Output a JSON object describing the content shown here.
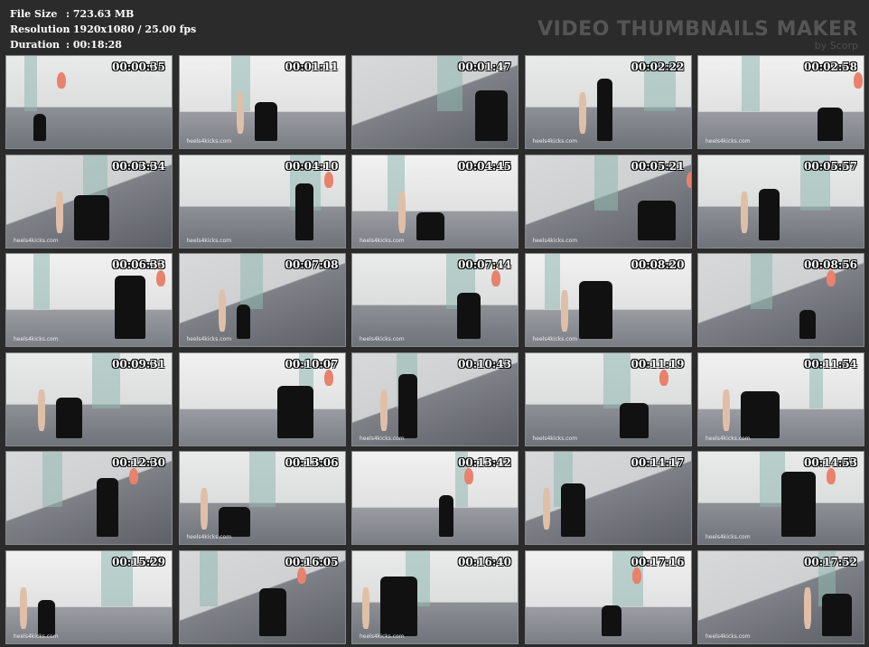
{
  "header": {
    "info": [
      {
        "label": "File Size",
        "value": ":  723.63 MB"
      },
      {
        "label": "Resolution",
        "value": ":  1920x1080 / 25.00 fps"
      },
      {
        "label": "Duration",
        "value": ":  00:18:28"
      }
    ],
    "brand": "VIDEO THUMBNAILS MAKER",
    "brand_sub": "by Scorp"
  },
  "thumbnails": [
    {
      "time": "00:00:35",
      "watermark": ""
    },
    {
      "time": "00:01:11",
      "watermark": "heels4kicks.com"
    },
    {
      "time": "00:01:47",
      "watermark": ""
    },
    {
      "time": "00:02:22",
      "watermark": "heels4kicks.com"
    },
    {
      "time": "00:02:58",
      "watermark": "heels4kicks.com"
    },
    {
      "time": "00:03:34",
      "watermark": "heels4kicks.com"
    },
    {
      "time": "00:04:10",
      "watermark": "heels4kicks.com"
    },
    {
      "time": "00:04:45",
      "watermark": "heels4kicks.com"
    },
    {
      "time": "00:05:21",
      "watermark": "heels4kicks.com"
    },
    {
      "time": "00:05:57",
      "watermark": ""
    },
    {
      "time": "00:06:33",
      "watermark": "heels4kicks.com"
    },
    {
      "time": "00:07:08",
      "watermark": "heels4kicks.com"
    },
    {
      "time": "00:07:44",
      "watermark": "heels4kicks.com"
    },
    {
      "time": "00:08:20",
      "watermark": "heels4kicks.com"
    },
    {
      "time": "00:08:56",
      "watermark": ""
    },
    {
      "time": "00:09:31",
      "watermark": ""
    },
    {
      "time": "00:10:07",
      "watermark": ""
    },
    {
      "time": "00:10:43",
      "watermark": "heels4kicks.com"
    },
    {
      "time": "00:11:19",
      "watermark": "heels4kicks.com"
    },
    {
      "time": "00:11:54",
      "watermark": "heels4kicks.com"
    },
    {
      "time": "00:12:30",
      "watermark": ""
    },
    {
      "time": "00:13:06",
      "watermark": "heels4kicks.com"
    },
    {
      "time": "00:13:42",
      "watermark": ""
    },
    {
      "time": "00:14:17",
      "watermark": ""
    },
    {
      "time": "00:14:53",
      "watermark": "heels4kicks.com"
    },
    {
      "time": "00:15:29",
      "watermark": "heels4kicks.com"
    },
    {
      "time": "00:16:05",
      "watermark": ""
    },
    {
      "time": "00:16:40",
      "watermark": "heels4kicks.com"
    },
    {
      "time": "00:17:16",
      "watermark": ""
    },
    {
      "time": "00:17:52",
      "watermark": "heels4kicks.com"
    }
  ]
}
